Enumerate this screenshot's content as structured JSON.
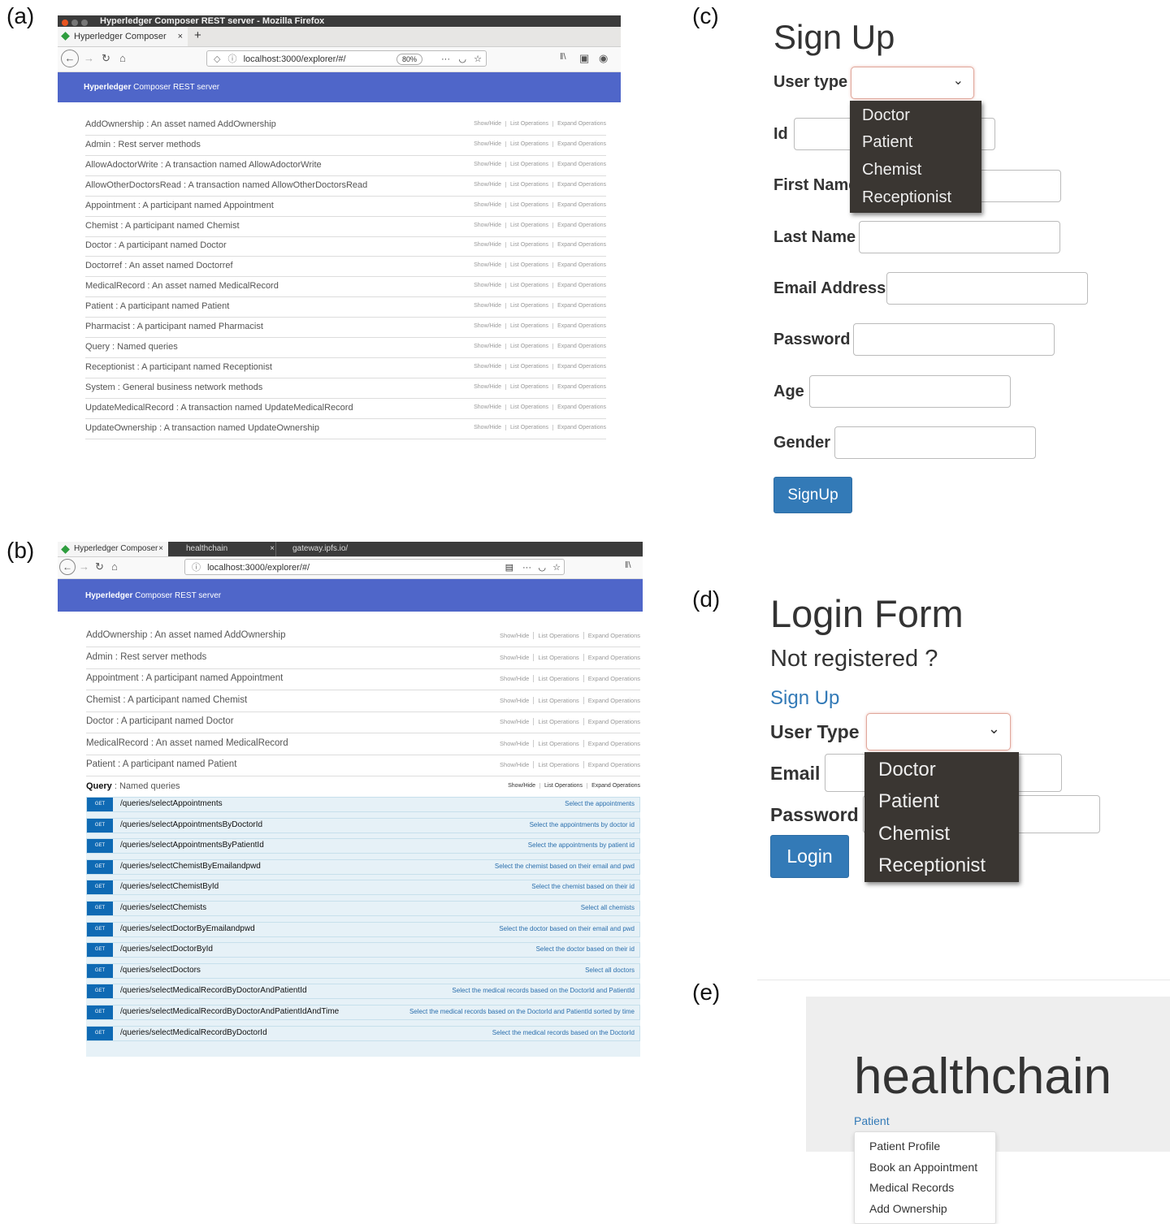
{
  "panel_labels": {
    "a": "(a)",
    "b": "(b)",
    "c": "(c)",
    "d": "(d)",
    "e": "(e)"
  },
  "panel_a": {
    "window_title": "Hyperledger Composer REST server - Mozilla Firefox",
    "tab_label": "Hyperledger Composer",
    "tab_close": "×",
    "new_tab": "+",
    "url": "localhost:3000/explorer/#/",
    "zoom": "80%",
    "banner_bold": "Hyperledger",
    "banner_rest": " Composer REST server",
    "ops": [
      "Show/Hide",
      "List Operations",
      "Expand Operations"
    ],
    "rows": [
      "AddOwnership : An asset named AddOwnership",
      "Admin : Rest server methods",
      "AllowAdoctorWrite : A transaction named AllowAdoctorWrite",
      "AllowOtherDoctorsRead : A transaction named AllowOtherDoctorsRead",
      "Appointment : A participant named Appointment",
      "Chemist : A participant named Chemist",
      "Doctor : A participant named Doctor",
      "Doctorref : An asset named Doctorref",
      "MedicalRecord : An asset named MedicalRecord",
      "Patient : A participant named Patient",
      "Pharmacist : A participant named Pharmacist",
      "Query : Named queries",
      "Receptionist : A participant named Receptionist",
      "System : General business network methods",
      "UpdateMedicalRecord : A transaction named UpdateMedicalRecord",
      "UpdateOwnership : A transaction named UpdateOwnership"
    ]
  },
  "panel_b": {
    "tabs": [
      "Hyperledger Composer",
      "healthchain",
      "gateway.ipfs.io/"
    ],
    "tab_close": "×",
    "url": "localhost:3000/explorer/#/",
    "banner_bold": "Hyperledger",
    "banner_rest": " Composer REST server",
    "ops": [
      "Show/Hide",
      "List Operations",
      "Expand Operations"
    ],
    "rows": [
      "AddOwnership : An asset named AddOwnership",
      "Admin : Rest server methods",
      "Appointment : A participant named Appointment",
      "Chemist : A participant named Chemist",
      "Doctor : A participant named Doctor",
      "MedicalRecord : An asset named MedicalRecord",
      "Patient : A participant named Patient"
    ],
    "query_bold": "Query",
    "query_rest": " : Named queries",
    "get_label": "GET",
    "queries": [
      {
        "path": "/queries/selectAppointments",
        "desc": "Select the appointments"
      },
      {
        "path": "/queries/selectAppointmentsByDoctorId",
        "desc": "Select the appointments by doctor id"
      },
      {
        "path": "/queries/selectAppointmentsByPatientId",
        "desc": "Select the appointments by patient id"
      },
      {
        "path": "/queries/selectChemistByEmailandpwd",
        "desc": "Select the chemist based on their email and pwd"
      },
      {
        "path": "/queries/selectChemistById",
        "desc": "Select the chemist based on their id"
      },
      {
        "path": "/queries/selectChemists",
        "desc": "Select all chemists"
      },
      {
        "path": "/queries/selectDoctorByEmailandpwd",
        "desc": "Select the doctor based on their email and pwd"
      },
      {
        "path": "/queries/selectDoctorById",
        "desc": "Select the doctor based on their id"
      },
      {
        "path": "/queries/selectDoctors",
        "desc": "Select all doctors"
      },
      {
        "path": "/queries/selectMedicalRecordByDoctorAndPatientId",
        "desc": "Select the medical records based on the DoctorId and PatientId"
      },
      {
        "path": "/queries/selectMedicalRecordByDoctorAndPatientIdAndTime",
        "desc": "Select the medical records based on the DoctorId and PatientId sorted by time"
      },
      {
        "path": "/queries/selectMedicalRecordByDoctorId",
        "desc": "Select the medical records based on the DoctorId"
      }
    ]
  },
  "panel_c": {
    "title": "Sign Up",
    "labels": [
      "User type",
      "Id",
      "First Name",
      "Last Name",
      "Email Address",
      "Password",
      "Age",
      "Gender"
    ],
    "options": [
      "Doctor",
      "Patient",
      "Chemist",
      "Receptionist"
    ],
    "button": "SignUp"
  },
  "panel_d": {
    "title": "Login Form",
    "subtitle": "Not registered ?",
    "signup_link": "Sign Up",
    "labels": [
      "User Type",
      "Email",
      "Password"
    ],
    "options": [
      "Doctor",
      "Patient",
      "Chemist",
      "Receptionist"
    ],
    "button": "Login"
  },
  "panel_e": {
    "brand": "healthchain",
    "nav": "Patient",
    "menu": [
      "Patient Profile",
      "Book an Appointment",
      "Medical Records",
      "Add Ownership"
    ]
  }
}
